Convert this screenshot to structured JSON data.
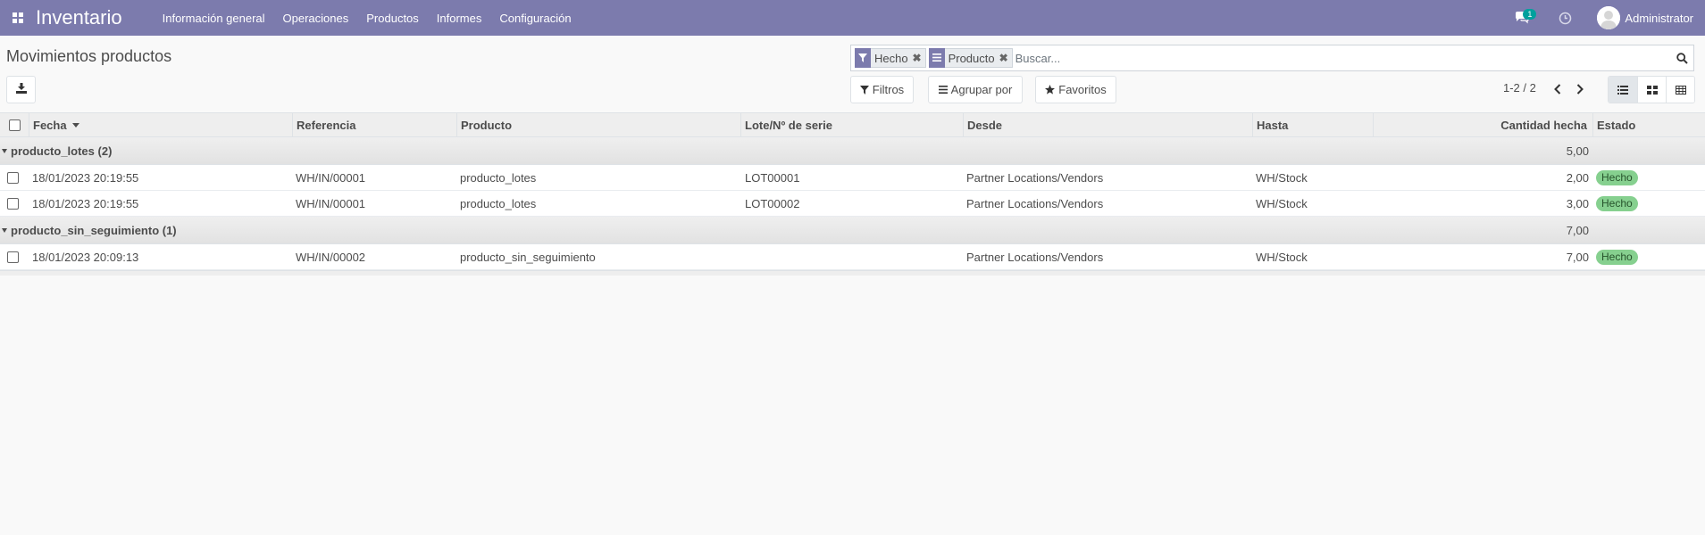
{
  "navbar": {
    "apps_icon": "apps-grid-icon",
    "brand": "Inventario",
    "menu": [
      "Información general",
      "Operaciones",
      "Productos",
      "Informes",
      "Configuración"
    ],
    "chat_badge": "1",
    "user": "Administrator"
  },
  "control_panel": {
    "title": "Movimientos productos",
    "search": {
      "facets": [
        {
          "icon": "filter-icon",
          "label": "Hecho"
        },
        {
          "icon": "group-by-icon",
          "label": "Producto"
        }
      ],
      "placeholder": "Buscar..."
    },
    "buttons": {
      "filters": "Filtros",
      "group_by": "Agrupar por",
      "favorites": "Favoritos"
    },
    "pager": "1-2 / 2"
  },
  "table": {
    "columns": [
      "Fecha",
      "Referencia",
      "Producto",
      "Lote/Nº de serie",
      "Desde",
      "Hasta",
      "Cantidad hecha",
      "Estado"
    ],
    "groups": [
      {
        "name": "producto_lotes (2)",
        "total": "5,00",
        "rows": [
          {
            "fecha": "18/01/2023 20:19:55",
            "referencia": "WH/IN/00001",
            "producto": "producto_lotes",
            "lote": "LOT00001",
            "desde": "Partner Locations/Vendors",
            "hasta": "WH/Stock",
            "cantidad": "2,00",
            "estado": "Hecho"
          },
          {
            "fecha": "18/01/2023 20:19:55",
            "referencia": "WH/IN/00001",
            "producto": "producto_lotes",
            "lote": "LOT00002",
            "desde": "Partner Locations/Vendors",
            "hasta": "WH/Stock",
            "cantidad": "3,00",
            "estado": "Hecho"
          }
        ]
      },
      {
        "name": "producto_sin_seguimiento (1)",
        "total": "7,00",
        "rows": [
          {
            "fecha": "18/01/2023 20:09:13",
            "referencia": "WH/IN/00002",
            "producto": "producto_sin_seguimiento",
            "lote": "",
            "desde": "Partner Locations/Vendors",
            "hasta": "WH/Stock",
            "cantidad": "7,00",
            "estado": "Hecho"
          }
        ]
      }
    ]
  },
  "colors": {
    "navbar": "#7c7bad",
    "badge_done": "#86d08f",
    "chat_badge": "#00a09d"
  }
}
